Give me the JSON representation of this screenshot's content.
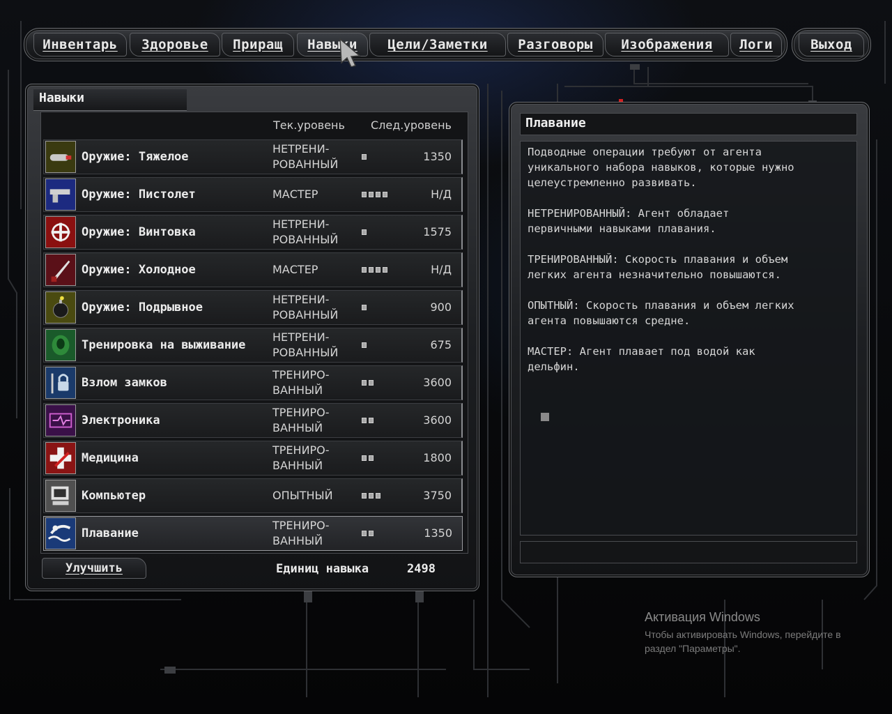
{
  "nav": {
    "tabs": [
      {
        "label": "Инвентарь",
        "active": false
      },
      {
        "label": "Здоровье",
        "active": false
      },
      {
        "label": "Приращ",
        "active": false
      },
      {
        "label": "Навыки",
        "active": true
      },
      {
        "label": "Цели/Заметки",
        "active": false
      },
      {
        "label": "Разговоры",
        "active": false
      },
      {
        "label": "Изображения",
        "active": false
      },
      {
        "label": "Логи",
        "active": false
      }
    ],
    "exit_label": "Выход"
  },
  "skills_panel": {
    "title": "Навыки",
    "col_current": "Тек.уровень",
    "col_next": "След.уровень",
    "skills": [
      {
        "name": "Оружие: Тяжелое",
        "level": "НЕТРЕНИ-\nРОВАННЫЙ",
        "dots": 1,
        "cost": "1350",
        "icon": "heavy-weapon-icon",
        "icon_color": "#3a3a10"
      },
      {
        "name": "Оружие: Пистолет",
        "level": "МАСТЕР",
        "dots": 4,
        "cost": "Н/Д",
        "icon": "pistol-icon",
        "icon_color": "#1c2a80"
      },
      {
        "name": "Оружие: Винтовка",
        "level": "НЕТРЕНИ-\nРОВАННЫЙ",
        "dots": 1,
        "cost": "1575",
        "icon": "rifle-icon",
        "icon_color": "#8a1010"
      },
      {
        "name": "Оружие: Холодное",
        "level": "МАСТЕР",
        "dots": 4,
        "cost": "Н/Д",
        "icon": "knife-icon",
        "icon_color": "#5a1018"
      },
      {
        "name": "Оружие: Подрывное",
        "level": "НЕТРЕНИ-\nРОВАННЫЙ",
        "dots": 1,
        "cost": "900",
        "icon": "bomb-icon",
        "icon_color": "#4a4a10"
      },
      {
        "name": "Тренировка на выживание",
        "level": "НЕТРЕНИ-\nРОВАННЫЙ",
        "dots": 1,
        "cost": "675",
        "icon": "survival-icon",
        "icon_color": "#1a5a2a"
      },
      {
        "name": "Взлом замков",
        "level": "ТРЕНИРО-\nВАННЫЙ",
        "dots": 2,
        "cost": "3600",
        "icon": "lockpick-icon",
        "icon_color": "#1a3a6a"
      },
      {
        "name": "Электроника",
        "level": "ТРЕНИРО-\nВАННЫЙ",
        "dots": 2,
        "cost": "3600",
        "icon": "electronics-icon",
        "icon_color": "#3a1048"
      },
      {
        "name": "Медицина",
        "level": "ТРЕНИРО-\nВАННЫЙ",
        "dots": 2,
        "cost": "1800",
        "icon": "medicine-icon",
        "icon_color": "#8a1414"
      },
      {
        "name": "Компьютер",
        "level": "ОПЫТНЫЙ",
        "dots": 3,
        "cost": "3750",
        "icon": "computer-icon",
        "icon_color": "#505050"
      },
      {
        "name": "Плавание",
        "level": "ТРЕНИРО-\nВАННЫЙ",
        "dots": 2,
        "cost": "1350",
        "icon": "swimming-icon",
        "icon_color": "#1a3a78",
        "selected": true
      }
    ],
    "upgrade_label": "Улучшить",
    "points_label": "Единиц навыка",
    "points_value": "2498"
  },
  "description_panel": {
    "title": "Плавание",
    "text": "Подводные операции требуют от агента\nуникального набора навыков, которые нужно\nцелеустремленно развивать.\n\nНЕТРЕНИРОВАННЫЙ: Агент обладает\nпервичными навыками плавания.\n\nТРЕНИРОВАННЫЙ: Скорость плавания и объем\nлегких агента незначительно повышаются.\n\nОПЫТНЫЙ: Скорость плавания и объем легких\nагента повышаются средне.\n\nМАСТЕР: Агент плавает под водой как\nдельфин."
  },
  "watermark": {
    "title": "Активация Windows",
    "text": "Чтобы активировать Windows, перейдите в раздел \"Параметры\"."
  },
  "colors": {
    "accent_red": "#d02020",
    "frame": "#6a6c70",
    "text": "#ececec"
  }
}
